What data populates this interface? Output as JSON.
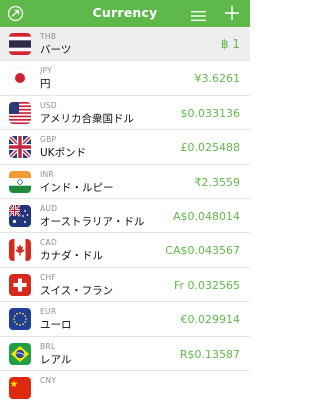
{
  "header": {
    "title": "Currency",
    "accent": "#5fb94a",
    "left_icon": "clock-icon",
    "menu_icon": "menu-icon",
    "add_icon": "plus-icon"
  },
  "currencies": [
    {
      "code": "THB",
      "name": "バーツ",
      "value": "฿ 1",
      "flag": "thailand-flag-icon"
    },
    {
      "code": "JPY",
      "name": "円",
      "value": "¥3.6261",
      "flag": "japan-flag-icon"
    },
    {
      "code": "USD",
      "name": "アメリカ合衆国ドル",
      "value": "$0.033136",
      "flag": "usa-flag-icon"
    },
    {
      "code": "GBP",
      "name": "UKポンド",
      "value": "£0.025488",
      "flag": "uk-flag-icon"
    },
    {
      "code": "INR",
      "name": "インド・ルピー",
      "value": "₹2.3559",
      "flag": "india-flag-icon"
    },
    {
      "code": "AUD",
      "name": "オーストラリア・ドル",
      "value": "A$0.048014",
      "flag": "australia-flag-icon"
    },
    {
      "code": "CAD",
      "name": "カナダ・ドル",
      "value": "CA$0.043567",
      "flag": "canada-flag-icon"
    },
    {
      "code": "CHF",
      "name": "スイス・フラン",
      "value": "Fr 0.032565",
      "flag": "switzerland-flag-icon"
    },
    {
      "code": "EUR",
      "name": "ユーロ",
      "value": "€0.029914",
      "flag": "eu-flag-icon"
    },
    {
      "code": "BRL",
      "name": "レアル",
      "value": "R$0.13587",
      "flag": "brazil-flag-icon"
    },
    {
      "code": "CNY",
      "name": "",
      "value": "",
      "flag": "china-flag-icon"
    }
  ]
}
